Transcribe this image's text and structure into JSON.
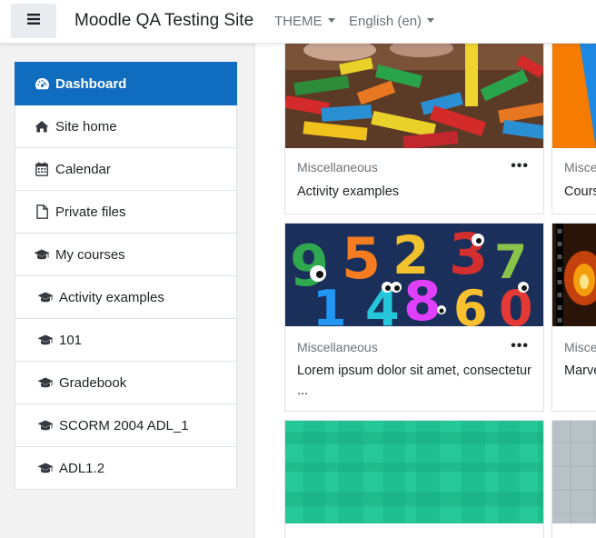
{
  "navbar": {
    "site_title": "Moodle QA Testing Site",
    "theme_label": "THEME",
    "language_label": "English (en)"
  },
  "drawer": {
    "items": [
      {
        "label": "Dashboard",
        "icon": "dashboard-icon",
        "active": true
      },
      {
        "label": "Site home",
        "icon": "home-icon"
      },
      {
        "label": "Calendar",
        "icon": "calendar-icon"
      },
      {
        "label": "Private files",
        "icon": "file-icon"
      },
      {
        "label": "My courses",
        "icon": "graduation-cap-icon"
      },
      {
        "label": "Activity examples",
        "icon": "graduation-cap-icon"
      },
      {
        "label": "101",
        "icon": "graduation-cap-icon"
      },
      {
        "label": "Gradebook",
        "icon": "graduation-cap-icon"
      },
      {
        "label": "SCORM 2004 ADL_1",
        "icon": "graduation-cap-icon"
      },
      {
        "label": "ADL1.2",
        "icon": "graduation-cap-icon"
      }
    ]
  },
  "courses": [
    {
      "category": "Miscellaneous",
      "name": "Activity examples",
      "image": "wooden-blocks"
    },
    {
      "category": "Misce",
      "name": "Cours",
      "image": "orange-pattern"
    },
    {
      "category": "Miscellaneous",
      "name": "Lorem ipsum dolor sit amet, consectetur ...",
      "image": "cartoon-numbers"
    },
    {
      "category": "Misce",
      "name": "Marve",
      "image": "film-strip"
    },
    {
      "category": "",
      "name": "",
      "image": "green-pattern"
    },
    {
      "category": "",
      "name": "",
      "image": "grey-pattern"
    }
  ],
  "colors": {
    "primary": "#0f6cbf",
    "muted_text": "#6a737b"
  }
}
